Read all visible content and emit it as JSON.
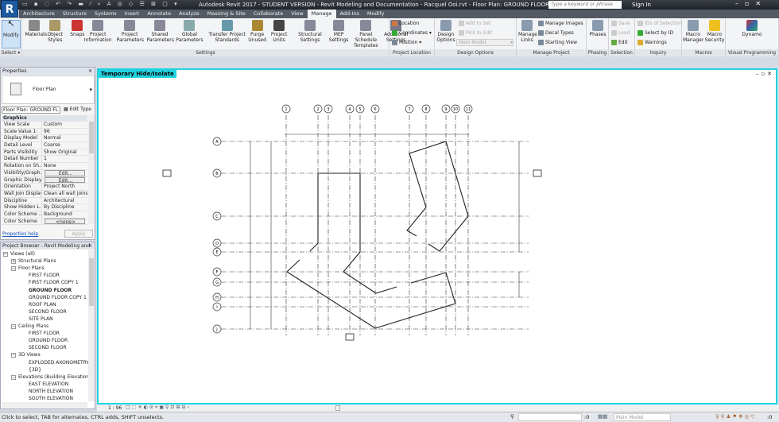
{
  "app": {
    "logo": "R",
    "title": "Autodesk Revit 2017 - STUDENT VERSION -    Revit Modeling and Documentation - Racquel Ooi.rvt - Floor Plan: GROUND FLOOR",
    "search_placeholder": "Type a keyword or phrase",
    "sign_in": "Sign In"
  },
  "tabs": [
    "Architecture",
    "Structure",
    "Systems",
    "Insert",
    "Annotate",
    "Analyze",
    "Massing & Site",
    "Collaborate",
    "View",
    "Manage",
    "Add-Ins",
    "Modify"
  ],
  "active_tab": "Manage",
  "ribbon": {
    "select": {
      "modify": "Modify",
      "label": "Select ▾"
    },
    "settings": {
      "label": "Settings",
      "items": [
        "Materials",
        "Object Styles",
        "Snaps",
        "Project Information",
        "Project Parameters",
        "Shared Parameters",
        "Global Parameters",
        "Transfer Project Standards",
        "Purge Unused",
        "Project Units",
        "Structural Settings",
        "MEP Settings",
        "Panel Schedule Templates",
        "Additional Settings"
      ]
    },
    "project_location": {
      "label": "Project Location",
      "items": [
        "Location",
        "Coordinates ▾",
        "Position ▾"
      ]
    },
    "design_options": {
      "label": "Design Options",
      "button": "Design Options",
      "add_to_set": "Add to Set",
      "pick_to_edit": "Pick to Edit",
      "current": "Main Model"
    },
    "manage_project": {
      "label": "Manage Project",
      "manage_links": "Manage Links",
      "items": [
        "Manage Images",
        "Decal Types",
        "Starting View"
      ]
    },
    "phasing": {
      "label": "Phasing",
      "phases": "Phases"
    },
    "selection": {
      "label": "Selection",
      "items": [
        "Save",
        "Load",
        "Edit"
      ]
    },
    "inquiry": {
      "label": "Inquiry",
      "items": [
        "IDs of Selection",
        "Select by ID",
        "Warnings"
      ]
    },
    "macros": {
      "label": "Macros",
      "items": [
        "Macro Manager",
        "Macro Security"
      ]
    },
    "visual_programming": {
      "label": "Visual Programming",
      "dynamo": "Dynamo"
    }
  },
  "properties": {
    "header": "Properties",
    "type": "Floor Plan",
    "selector": "Floor Plan: GROUND FL",
    "edit_type": "Edit Type",
    "section": "Graphics",
    "rows": [
      [
        "View Scale",
        "Custom"
      ],
      [
        "Scale Value    1:",
        "96"
      ],
      [
        "Display Model",
        "Normal"
      ],
      [
        "Detail Level",
        "Coarse"
      ],
      [
        "Parts Visibility",
        "Show Original"
      ],
      [
        "Detail Number",
        "1"
      ],
      [
        "Rotation on Sh...",
        "None"
      ],
      [
        "Visibility/Graph...",
        "Edit..."
      ],
      [
        "Graphic Display...",
        "Edit..."
      ],
      [
        "Orientation",
        "Project North"
      ],
      [
        "Wall Join Display",
        "Clean all wall joins"
      ],
      [
        "Discipline",
        "Architectural"
      ],
      [
        "Show Hidden L...",
        "By Discipline"
      ],
      [
        "Color Scheme ...",
        "Background"
      ],
      [
        "Color Scheme",
        "<none>"
      ]
    ],
    "help": "Properties help",
    "apply": "Apply"
  },
  "browser": {
    "header": "Project Browser - Revit Modeling and ...",
    "items": [
      {
        "t": "Views (all)",
        "lvl": 0,
        "exp": "−"
      },
      {
        "t": "Structural Plans",
        "lvl": 1,
        "exp": "+"
      },
      {
        "t": "Floor Plans",
        "lvl": 1,
        "exp": "−"
      },
      {
        "t": "FIRST FLOOR",
        "lvl": 2
      },
      {
        "t": "FIRST FLOOR COPY 1",
        "lvl": 2
      },
      {
        "t": "GROUND FLOOR",
        "lvl": 2,
        "bold": true
      },
      {
        "t": "GROUND FLOOR COPY 1",
        "lvl": 2
      },
      {
        "t": "ROOF PLAN",
        "lvl": 2
      },
      {
        "t": "SECOND FLOOR",
        "lvl": 2
      },
      {
        "t": "SITE PLAN",
        "lvl": 2
      },
      {
        "t": "Ceiling Plans",
        "lvl": 1,
        "exp": "−"
      },
      {
        "t": "FIRST FLOOR",
        "lvl": 2
      },
      {
        "t": "GROUND FLOOR",
        "lvl": 2
      },
      {
        "t": "SECOND FLOOR",
        "lvl": 2
      },
      {
        "t": "3D Views",
        "lvl": 1,
        "exp": "−"
      },
      {
        "t": "EXPLODED AXONOMETRY",
        "lvl": 2
      },
      {
        "t": "{3D}",
        "lvl": 2
      },
      {
        "t": "Elevations (Building Elevation)",
        "lvl": 1,
        "exp": "−"
      },
      {
        "t": "EAST ELEVATION",
        "lvl": 2
      },
      {
        "t": "NORTH ELEVATION",
        "lvl": 2
      },
      {
        "t": "SOUTH ELEVATION",
        "lvl": 2
      }
    ]
  },
  "view": {
    "label": "Temporary Hide/Isolate",
    "scale": "1 : 96",
    "grid_columns": [
      "1",
      "2",
      "3",
      "4",
      "5",
      "6",
      "7",
      "8",
      "9",
      "10",
      "11"
    ],
    "grid_rows": [
      "A",
      "B",
      "C",
      "D",
      "E",
      "F",
      "G",
      "H",
      "I",
      "J"
    ]
  },
  "status": {
    "hint": "Click to select, TAB for alternates, CTRL adds, SHIFT unselects.",
    "model": "Main Model",
    "filter_count": ":0",
    "worksets": ":0"
  },
  "colors": {
    "accent": "#21d3e0",
    "ribbon_bg": "#f3f4f6",
    "tabbar": "#545a63"
  }
}
